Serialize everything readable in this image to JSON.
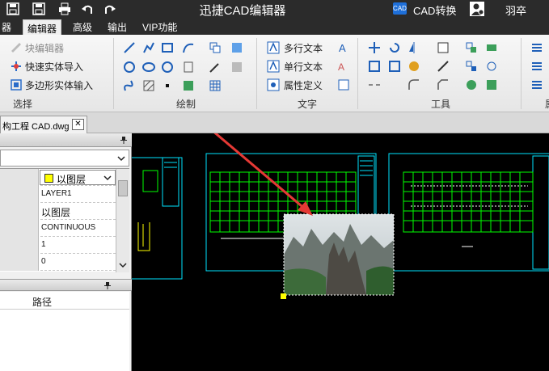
{
  "titlebar": {
    "title": "迅捷CAD编辑器",
    "cad_badge": "CAD",
    "convert_label": "CAD转换",
    "user_name": "羽卒"
  },
  "menu": {
    "items": [
      "器",
      "编辑器",
      "高级",
      "输出",
      "VIP功能"
    ],
    "active": "编辑器"
  },
  "ribbon": {
    "select_group": {
      "label": "选择",
      "block_editor": "块编辑器",
      "quick_import": "快速实体导入",
      "polygon_input": "多边形实体输入"
    },
    "draw_group": {
      "label": "绘制"
    },
    "text_group": {
      "label": "文字",
      "mtext": "多行文本",
      "stext": "单行文本",
      "attr_def": "属性定义"
    },
    "tools_group": {
      "label": "工具"
    },
    "cut_label": "属"
  },
  "document": {
    "tab_label": "构工程 CAD.dwg",
    "close_glyph": "✕"
  },
  "properties": {
    "pin_glyph": "📌",
    "layer_value": "以图层",
    "rows": [
      "LAYER1",
      "以图层",
      "CONTINUOUS",
      "1",
      "0"
    ]
  },
  "second_panel": {
    "column_header": "路径"
  },
  "colors": {
    "accent_cyan": "#00e5ff",
    "accent_green": "#00ff00",
    "arrow_red": "#e53935",
    "canvas_bg": "#000000",
    "handle_yellow": "#ffff00"
  },
  "icons": [
    "save-icon",
    "print-icon",
    "undo-icon",
    "redo-icon",
    "user-icon",
    "pin-icon",
    "chevron-down-icon",
    "close-icon"
  ]
}
